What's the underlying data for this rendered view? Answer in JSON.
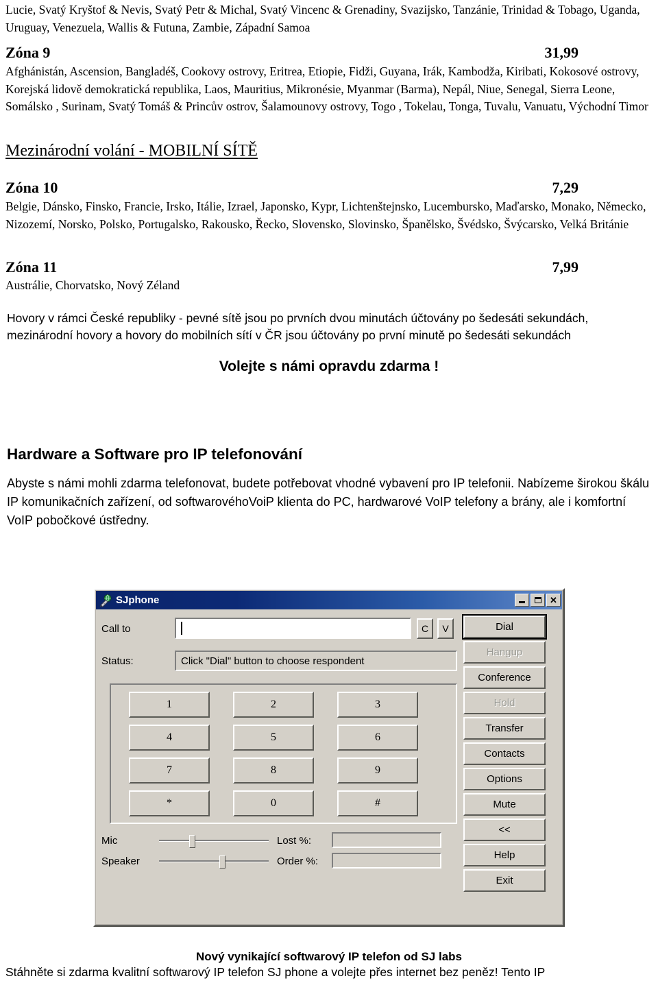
{
  "page": {
    "continued_country_list": "Lucie, Svatý Kryštof & Nevis, Svatý Petr & Michal, Svatý Vincenc & Grenadiny, Svazijsko, Tanzánie, Trinidad & Tobago, Uganda, Uruguay, Venezuela, Wallis & Futuna, Zambie, Západní Samoa",
    "zones": [
      {
        "name": "Zóna 9",
        "price": "31,99",
        "countries": "Afghánistán, Ascension, Bangladéš, Cookovy ostrovy, Eritrea, Etiopie, Fidži, Guyana, Irák, Kambodža, Kiribati, Kokosové ostrovy, Korejská lidově demokratická republika, Laos, Mauritius, Mikronésie, Myanmar (Barma), Nepál, Niue, Senegal, Sierra Leone, Somálsko , Surinam, Svatý Tomáš & Princův ostrov, Šalamounovy ostrovy, Togo , Tokelau, Tonga, Tuvalu, Vanuatu, Východní Timor"
      },
      {
        "name": "Zóna 10",
        "price": "7,29",
        "countries": "Belgie, Dánsko, Finsko, Francie, Irsko, Itálie, Izrael, Japonsko, Kypr, Lichtenštejnsko, Lucembursko, Maďarsko, Monako, Německo, Nizozemí, Norsko, Polsko, Portugalsko, Rakousko, Řecko, Slovensko, Slovinsko, Španělsko, Švédsko, Švýcarsko, Velká Británie"
      },
      {
        "name": "Zóna 11",
        "price": "7,99",
        "countries": "Austrálie, Chorvatsko, Nový Zéland"
      }
    ],
    "mobile_section_heading": "Mezinárodní volání - MOBILNÍ SÍTĚ",
    "billing_note": "Hovory v rámci České republiky - pevné sítě jsou po prvních dvou minutách účtovány po šedesáti sekundách, mezinárodní hovory a hovory do mobilních sítí v ČR jsou účtovány po první minutě po šedesáti sekundách",
    "free_call_slogan": "Volejte s námi opravdu zdarma !",
    "hardware_heading": "Hardware a Software pro IP telefonování",
    "hardware_paragraph": "Abyste s námi mohli zdarma telefonovat, budete potřebovat vhodné vybavení pro IP telefonii. Nabízeme širokou škálu IP komunikačních zařízení, od softwarovéhoVoiP klienta do PC, hardwarové VoIP telefony a brány, ale i komfortní VoIP pobočkové ústředny.",
    "footer_heading": "Nový vynikající softwarový IP telefon od SJ labs",
    "footer_paragraph": "Stáhněte si zdarma kvalitní softwarový IP telefon SJ phone a volejte přes internet bez peněz! Tento IP"
  },
  "sjphone": {
    "title": "SJphone",
    "icon": "phone-globe-icon",
    "window_controls": {
      "minimize": "minimize-icon",
      "maximize": "maximize-icon",
      "close": "✕"
    },
    "call_to_label": "Call to",
    "call_to_value": "",
    "clipboard_copy_button": "C",
    "clipboard_paste_button": "V",
    "status_label": "Status:",
    "status_value": "Click \"Dial\" button to choose respondent",
    "keypad": [
      "1",
      "2",
      "3",
      "4",
      "5",
      "6",
      "7",
      "8",
      "9",
      "*",
      "0",
      "#"
    ],
    "action_buttons": [
      {
        "label": "Dial",
        "state": "default"
      },
      {
        "label": "Hangup",
        "state": "disabled"
      },
      {
        "label": "Conference",
        "state": "enabled"
      },
      {
        "label": "Hold",
        "state": "disabled"
      },
      {
        "label": "Transfer",
        "state": "enabled"
      },
      {
        "label": "Contacts",
        "state": "enabled"
      },
      {
        "label": "Options",
        "state": "enabled"
      },
      {
        "label": "Mute",
        "state": "enabled"
      },
      {
        "label": "<<",
        "state": "enabled"
      },
      {
        "label": "Help",
        "state": "enabled"
      },
      {
        "label": "Exit",
        "state": "enabled"
      }
    ],
    "mic_label": "Mic",
    "mic_value": 30,
    "speaker_label": "Speaker",
    "speaker_value": 58,
    "lost_label": "Lost %:",
    "lost_value": "",
    "order_label": "Order %:",
    "order_value": "",
    "colors": {
      "titlebar_start": "#0a246a",
      "titlebar_end": "#5f88c9",
      "face": "#d4d0c8",
      "shadow": "#808080",
      "highlight": "#ffffff"
    }
  }
}
